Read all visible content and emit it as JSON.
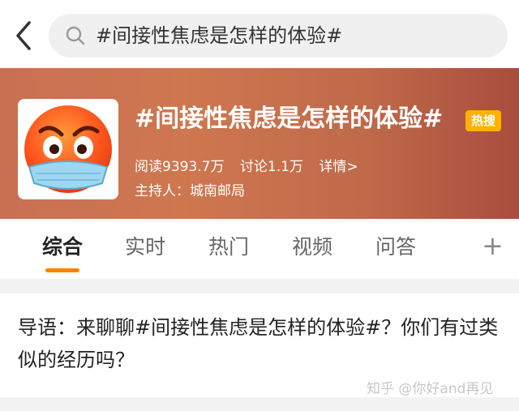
{
  "search": {
    "query": "#间接性焦虑是怎样的体验#"
  },
  "topic": {
    "title": "#间接性焦虑是怎样的体验#",
    "badge": "热搜",
    "reads": "阅读9393.7万",
    "discussions": "讨论1.1万",
    "details_link": "详情>",
    "host": "主持人：城南邮局"
  },
  "tabs": [
    {
      "label": "综合",
      "active": true
    },
    {
      "label": "实时",
      "active": false
    },
    {
      "label": "热门",
      "active": false
    },
    {
      "label": "视频",
      "active": false
    },
    {
      "label": "问答",
      "active": false
    }
  ],
  "tab_add_label": "+",
  "guide": {
    "text": "导语：来聊聊#间接性焦虑是怎样的体验#？你们有过类似的经历吗？"
  },
  "watermark": "知乎 @你好and再见",
  "colors": {
    "accent": "#ff8200",
    "badge": "#ffb100",
    "banner": "#cf774f"
  }
}
